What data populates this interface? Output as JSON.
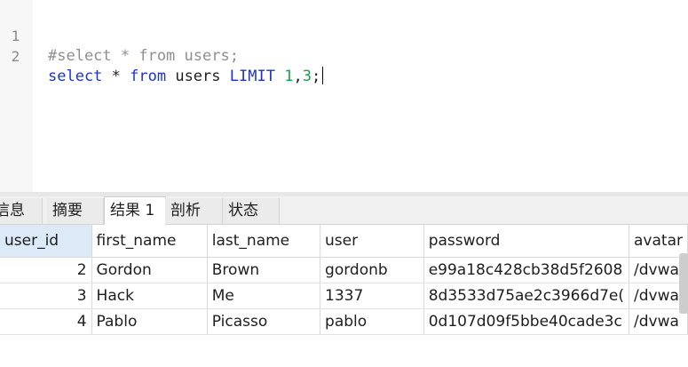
{
  "editor": {
    "lines": [
      {
        "number": "1",
        "comment": "#select * from users;"
      },
      {
        "number": "2",
        "kw_select": "select",
        "star": " * ",
        "kw_from": "from",
        "table": " users ",
        "kw_limit": "LIMIT",
        "space": " ",
        "offset": "1",
        "comma": ",",
        "count": "3",
        "semicolon": ";"
      }
    ]
  },
  "tabs": [
    "信息",
    "摘要",
    "结果 1",
    "剖析",
    "状态"
  ],
  "active_tab": "结果 1",
  "result": {
    "columns": [
      "user_id",
      "first_name",
      "last_name",
      "user",
      "password",
      "avatar"
    ],
    "rows": [
      [
        "2",
        "Gordon",
        "Brown",
        "gordonb",
        "e99a18c428cb38d5f2608",
        "/dvwa"
      ],
      [
        "3",
        "Hack",
        "Me",
        "1337",
        "8d3533d75ae2c3966d7e(",
        "/dvwa"
      ],
      [
        "4",
        "Pablo",
        "Picasso",
        "pablo",
        "0d107d09f5bbe40cade3c",
        "/dvwa"
      ]
    ]
  },
  "colors": {
    "keyword": "#1a33cc",
    "number": "#15a34a",
    "comment": "#8f8f8f",
    "selected_header": "#dce9f7"
  }
}
